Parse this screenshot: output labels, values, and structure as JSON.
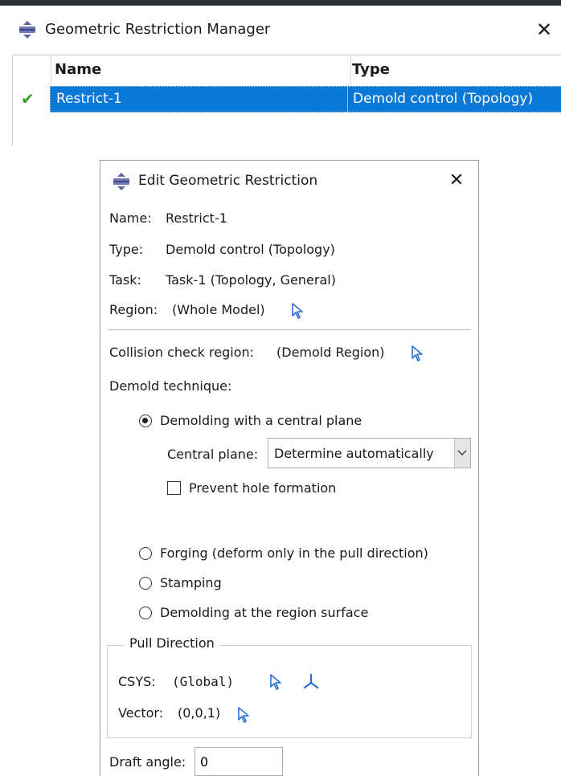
{
  "manager": {
    "title": "Geometric Restriction Manager",
    "columns": [
      "Name",
      "Type"
    ],
    "rows": [
      {
        "status": "✔",
        "name": "Restrict-1",
        "type": "Demold control (Topology)",
        "selected": true
      }
    ]
  },
  "dialog": {
    "title": "Edit Geometric Restriction",
    "name_label": "Name:",
    "name_value": "Restrict-1",
    "type_label": "Type:",
    "type_value": "Demold control (Topology)",
    "task_label": "Task:",
    "task_value": "Task-1 (Topology, General)",
    "region_label": "Region:",
    "region_value": "(Whole Model)",
    "collision_label": "Collision check region:",
    "collision_value": "(Demold Region)",
    "technique_label": "Demold technique:",
    "technique_options": [
      {
        "label": "Demolding with a central plane",
        "selected": true
      },
      {
        "label": "Forging (deform only in the pull direction)",
        "selected": false
      },
      {
        "label": "Stamping",
        "selected": false
      },
      {
        "label": "Demolding at the region surface",
        "selected": false
      }
    ],
    "central_plane_label": "Central plane:",
    "central_plane_value": "Determine automatically",
    "prevent_hole_label": "Prevent hole formation",
    "prevent_hole_checked": false,
    "pull_direction": {
      "legend": "Pull Direction",
      "csys_label": "CSYS:",
      "csys_value": "(Global)",
      "vector_label": "Vector:",
      "vector_value": "(0,0,1)"
    },
    "draft_angle_label": "Draft angle:",
    "draft_angle_value": "0"
  },
  "icons": {
    "app": "abaqus-module-icon",
    "close": "close-icon",
    "select": "select-arrow-icon",
    "csys": "csys-axes-icon",
    "dropdown": "chevron-down-icon",
    "check": "checkmark-icon"
  },
  "colors": {
    "selection": "#0a78d7",
    "check": "#3a9a2a",
    "pick_arrow": "#2b6fd6",
    "title_bar_line": "#2b3037"
  }
}
